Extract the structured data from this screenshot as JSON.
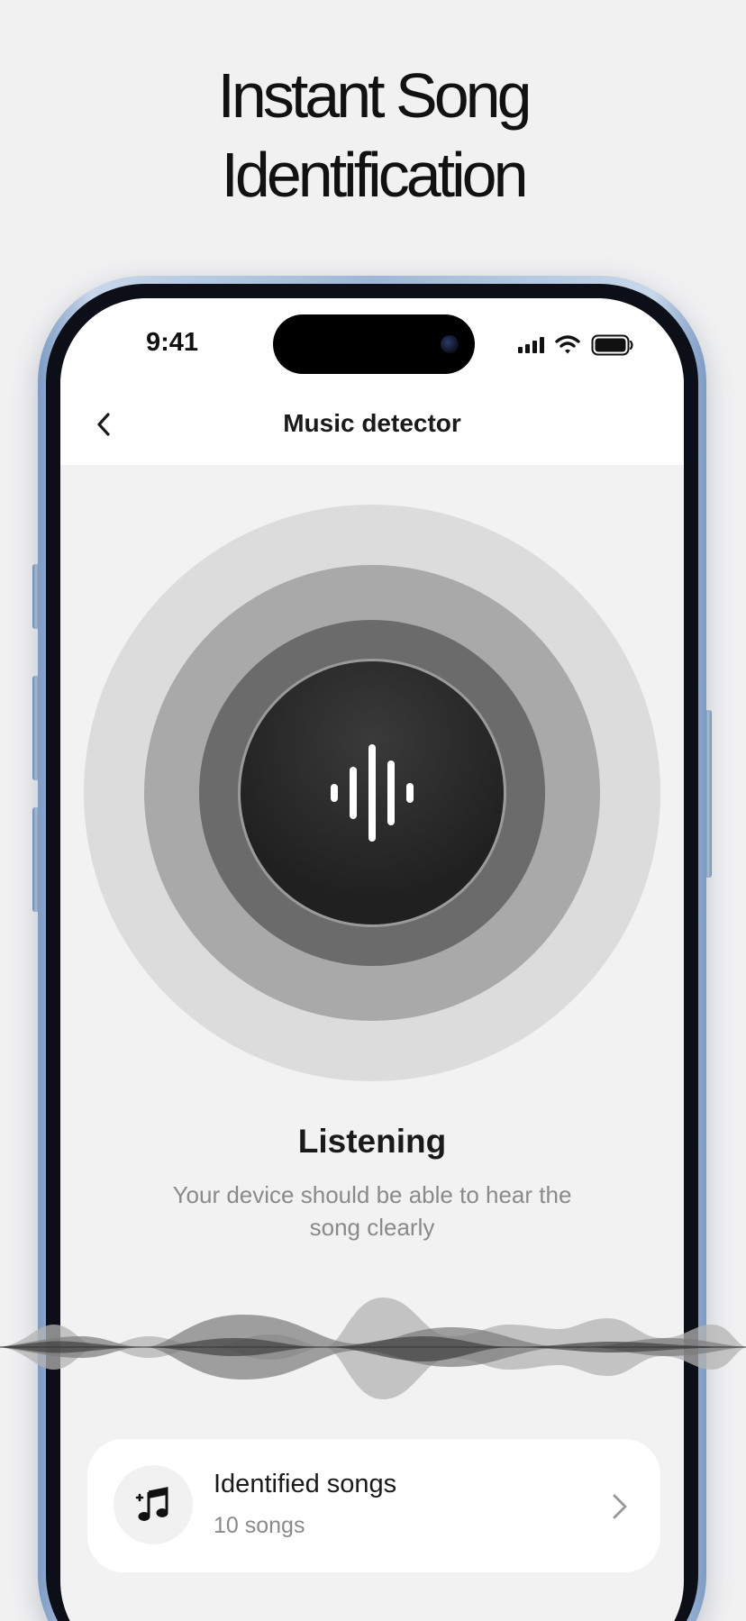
{
  "headline": {
    "line1": "Instant Song",
    "line2": "Identification"
  },
  "status_bar": {
    "time": "9:41",
    "icons": [
      "signal-icon",
      "wifi-icon",
      "battery-icon"
    ]
  },
  "nav": {
    "title": "Music detector",
    "back_icon": "chevron-left-icon"
  },
  "detector": {
    "center_icon": "sound-wave-icon",
    "state_title": "Listening",
    "state_description": "Your device should be able to hear the song clearly"
  },
  "identified_card": {
    "icon": "music-note-icon",
    "title": "Identified songs",
    "subtitle": "10 songs",
    "chevron_icon": "chevron-right-icon"
  },
  "colors": {
    "background": "#f1f1f2",
    "screen": "#f2f2f2",
    "ring_outer": "#dcdcdc",
    "ring_middle": "#a9a9a9",
    "ring_inner": "#6b6b6b",
    "button": "#202020",
    "text_primary": "#1a1a1a",
    "text_secondary": "#8a8a8a",
    "phone_frame": "#9fb7d6"
  }
}
